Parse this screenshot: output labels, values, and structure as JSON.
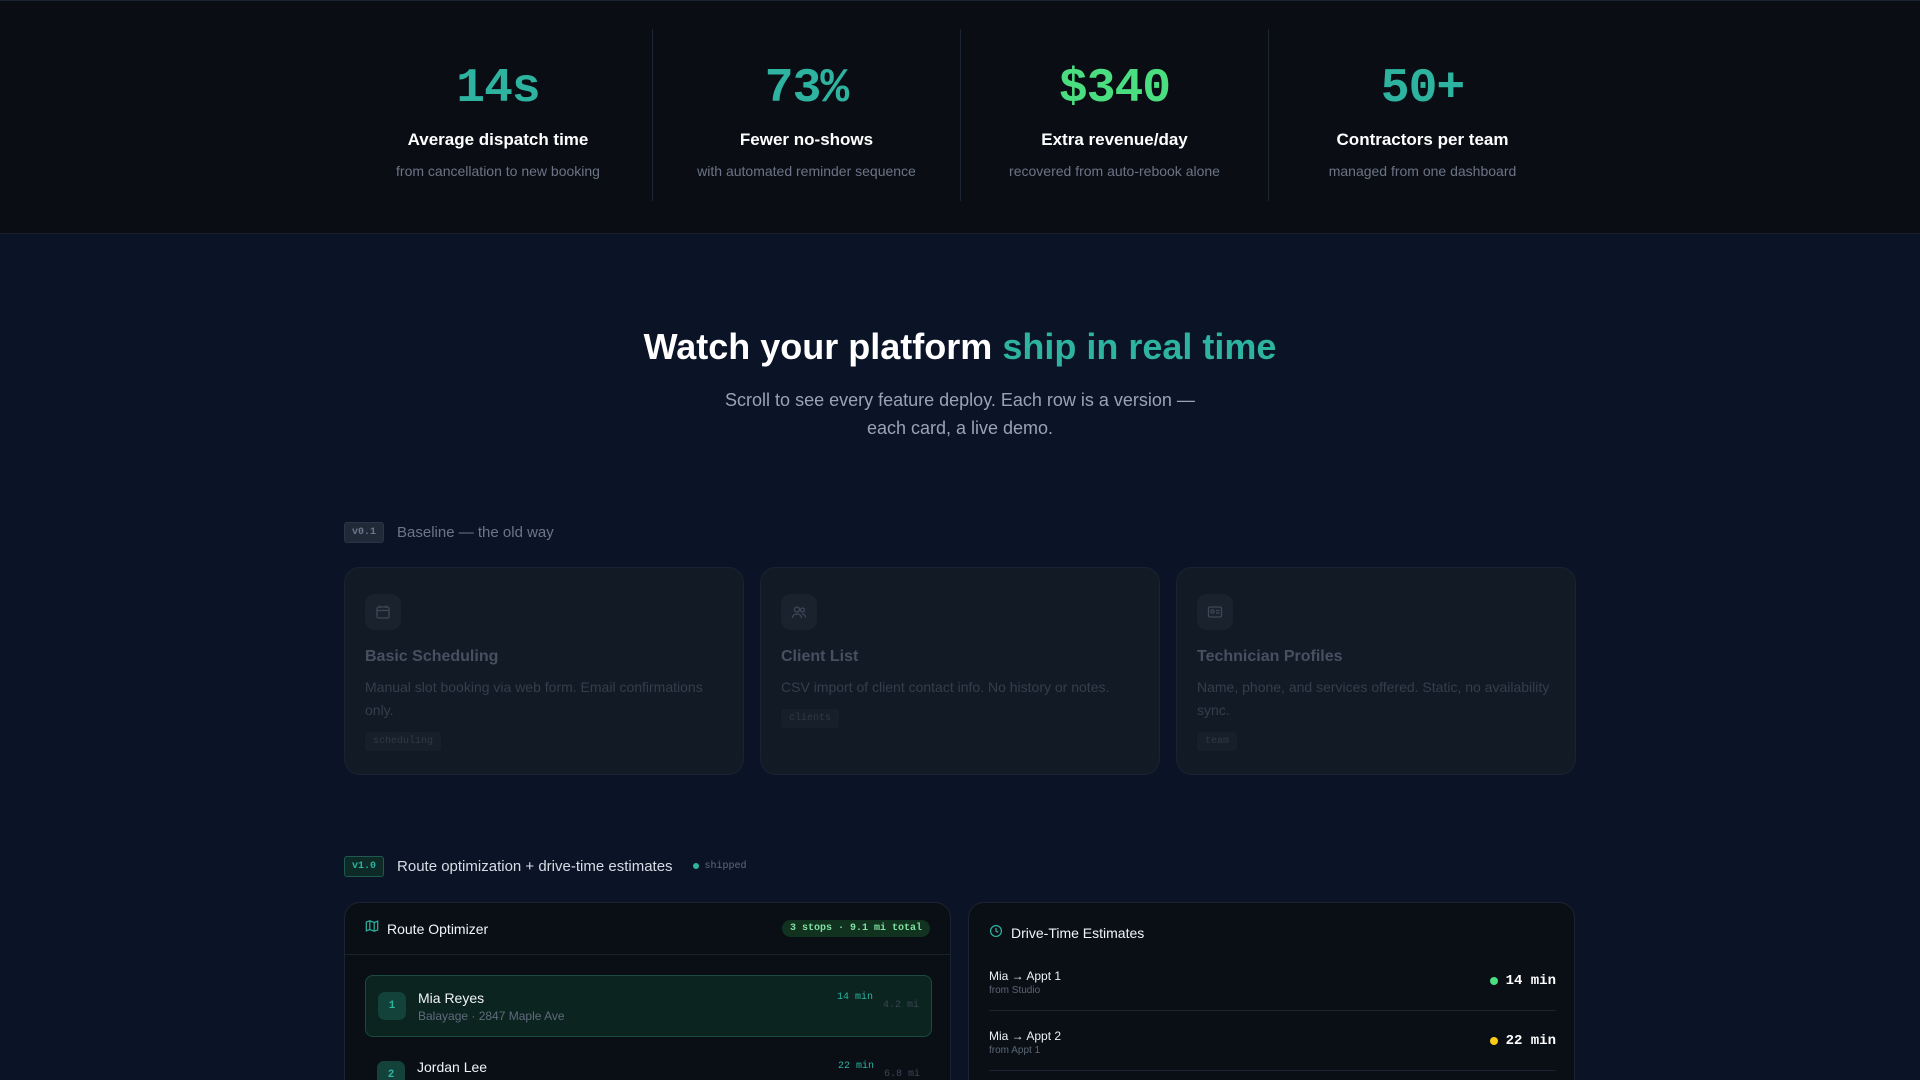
{
  "stats": [
    {
      "value": "14s",
      "title": "Average dispatch time",
      "subtitle": "from cancellation to new booking",
      "color": "#2db3a0"
    },
    {
      "value": "73%",
      "title": "Fewer no-shows",
      "subtitle": "with automated reminder sequence",
      "color": "#2db3a0"
    },
    {
      "value": "$340",
      "title": "Extra revenue/day",
      "subtitle": "recovered from auto-rebook alone",
      "color": "#4ade80"
    },
    {
      "value": "50+",
      "title": "Contractors per team",
      "subtitle": "managed from one dashboard",
      "color": "#2db3a0"
    }
  ],
  "hero": {
    "title_main": "Watch your platform",
    "title_accent": "ship in real time",
    "subtitle": "Scroll to see every feature deploy. Each row is a version — each card, a live demo."
  },
  "baseline": {
    "version": "v0.1",
    "label": "Baseline — the old way",
    "cards": [
      {
        "icon": "calendar-icon",
        "title": "Basic Scheduling",
        "description": "Manual slot booking via web form. Email confirmations only.",
        "tag": "scheduling"
      },
      {
        "icon": "users-icon",
        "title": "Client List",
        "description": "CSV import of client contact info. No history or notes.",
        "tag": "clients"
      },
      {
        "icon": "id-card-icon",
        "title": "Technician Profiles",
        "description": "Name, phone, and services offered. Static, no availability sync.",
        "tag": "team"
      }
    ]
  },
  "release": {
    "version": "v1.0",
    "label": "Route optimization + drive-time estimates",
    "status": "shipped"
  },
  "route_optimizer": {
    "icon": "map-icon",
    "title": "Route Optimizer",
    "summary": "3 stops · 9.1 mi total",
    "stops": [
      {
        "num": "1",
        "name": "Mia Reyes",
        "detail": "Balayage · 2847 Maple Ave",
        "time": "14 min",
        "distance": "4.2 mi"
      },
      {
        "num": "2",
        "name": "Jordan Lee",
        "detail": "",
        "time": "22 min",
        "distance": "6.8 mi"
      }
    ]
  },
  "drive_time": {
    "icon": "clock-icon",
    "title": "Drive-Time Estimates",
    "rows": [
      {
        "route": "Mia → Appt 1",
        "from": "from Studio",
        "time": "14 min",
        "status_color": "#4ade80"
      },
      {
        "route": "Mia → Appt 2",
        "from": "from Appt 1",
        "time": "22 min",
        "status_color": "#facc15"
      }
    ]
  }
}
